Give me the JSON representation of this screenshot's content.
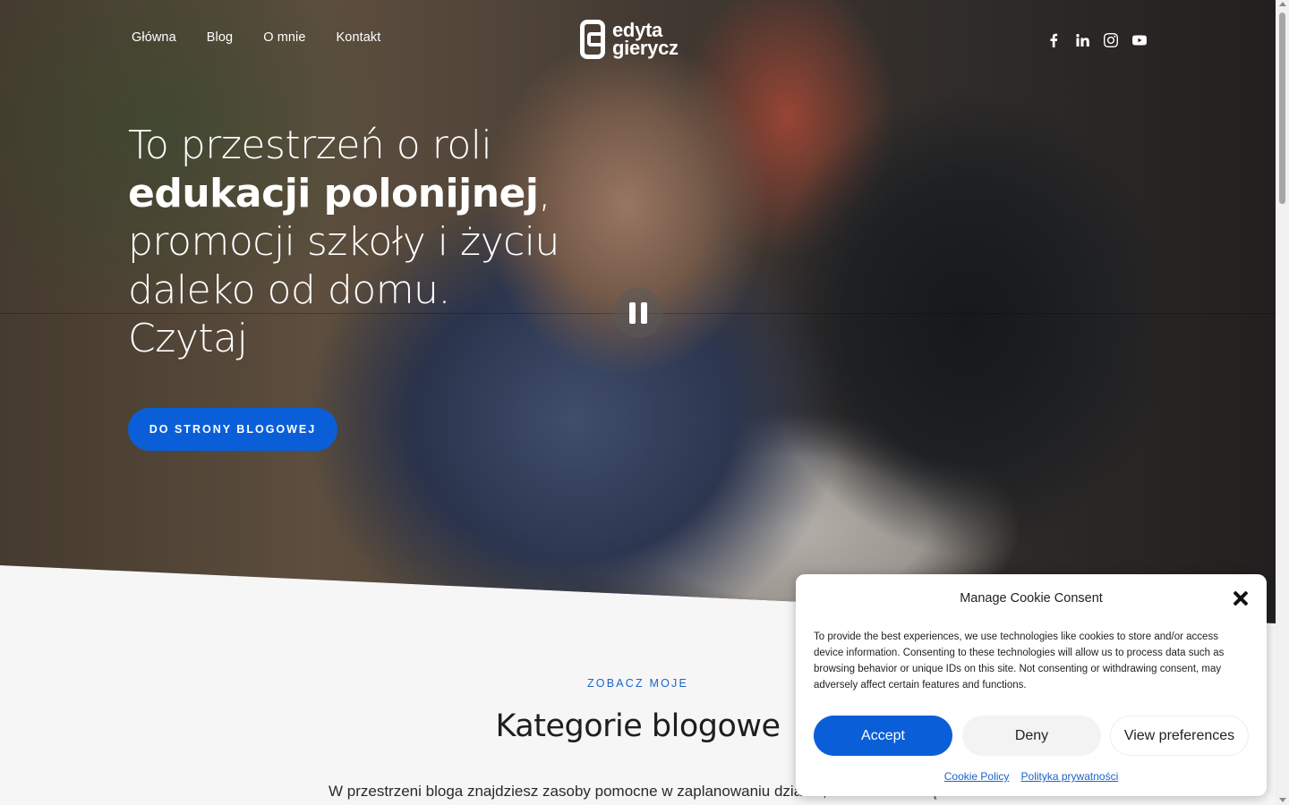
{
  "nav": {
    "items": [
      {
        "label": "Główna"
      },
      {
        "label": "Blog"
      },
      {
        "label": "O mnie"
      },
      {
        "label": "Kontakt"
      }
    ]
  },
  "logo": {
    "line1": "edyta",
    "line2": "gierycz"
  },
  "social": [
    "facebook-icon",
    "linkedin-icon",
    "instagram-icon",
    "youtube-icon"
  ],
  "hero": {
    "headline_part1": "To przestrzeń o roli ",
    "headline_bold": "edukacji polonijnej",
    "headline_part2": ", promocji szkoły i życiu daleko od domu. Czytaj",
    "cta_label": "DO STRONY BLOGOWEJ"
  },
  "section": {
    "eyebrow": "ZOBACZ MOJE",
    "title": "Kategorie blogowe",
    "text": "W przestrzeni bloga znajdziesz zasoby pomocne w zaplanowaniu działań, które wzmocnią"
  },
  "cookie": {
    "title": "Manage Cookie Consent",
    "body": "To provide the best experiences, we use technologies like cookies to store and/or access device information. Consenting to these technologies will allow us to process data such as browsing behavior or unique IDs on this site. Not consenting or withdrawing consent, may adversely affect certain features and functions.",
    "accept": "Accept",
    "deny": "Deny",
    "preferences": "View preferences",
    "link_cookie_policy": "Cookie Policy",
    "link_privacy": "Polityka prywatności"
  },
  "colors": {
    "accent": "#0a5fd9",
    "link": "#1a63c9"
  }
}
